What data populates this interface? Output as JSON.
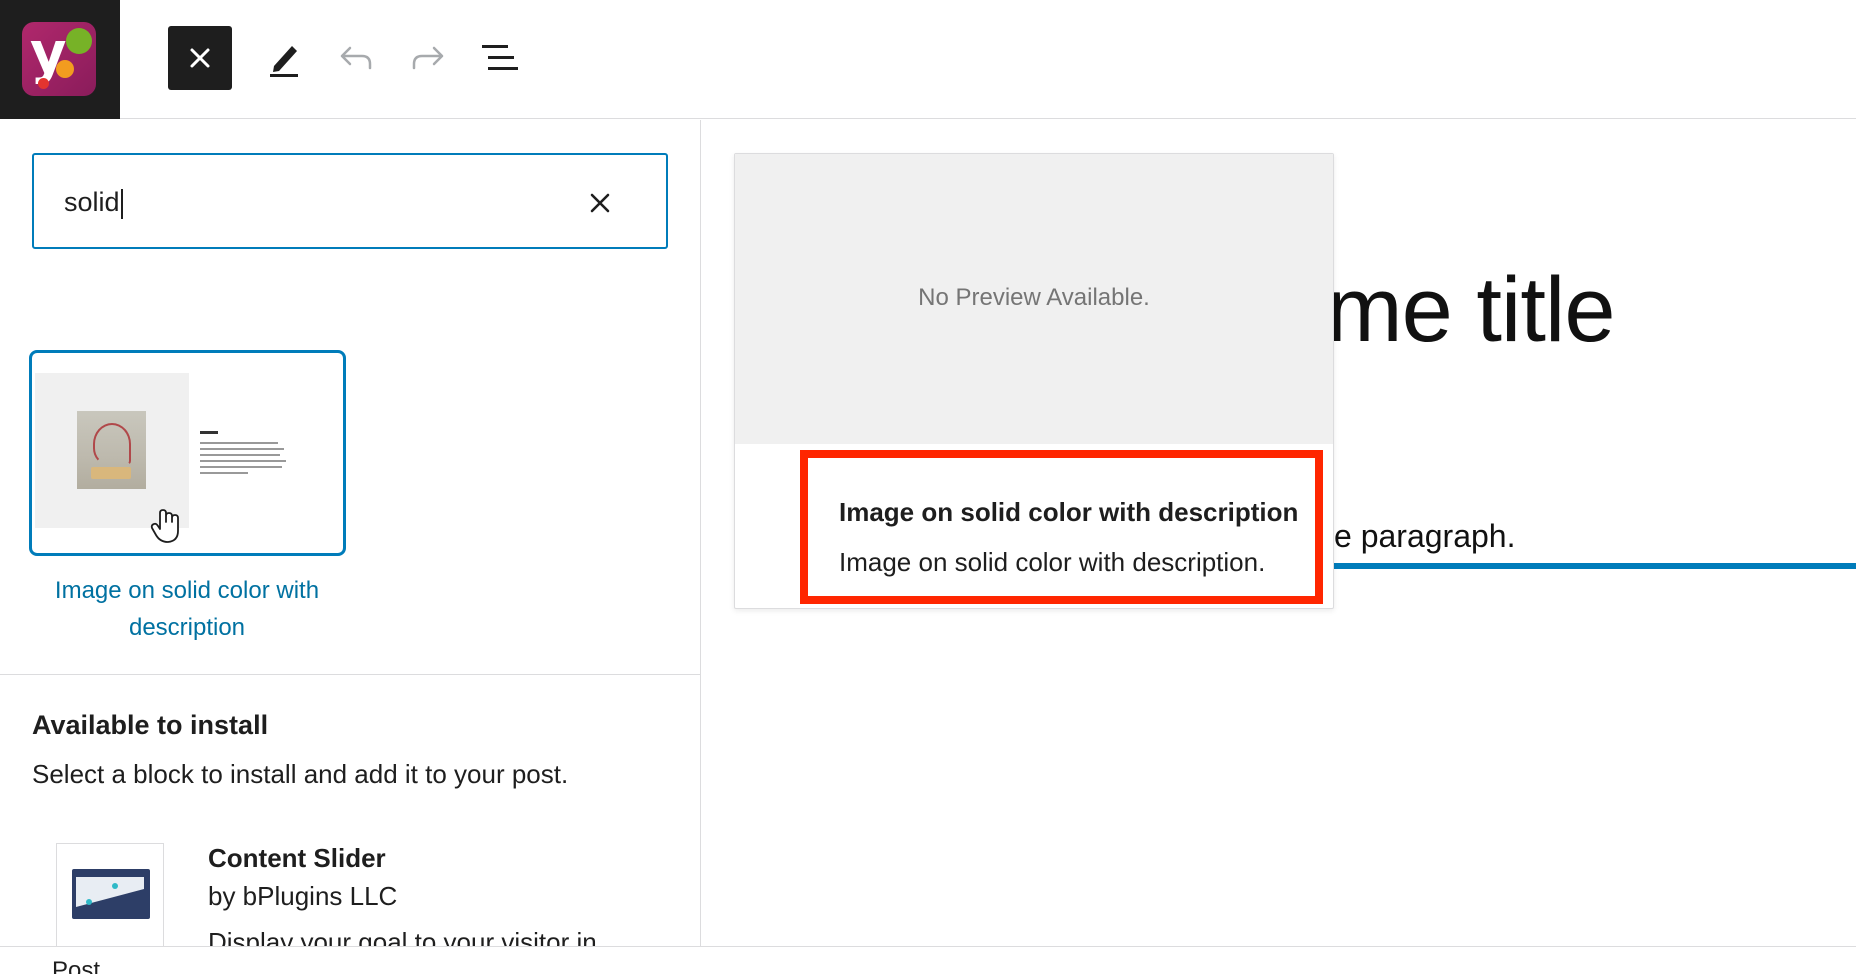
{
  "toolbar": {
    "close_icon": "close-icon",
    "edit_icon": "pencil-icon",
    "undo_icon": "undo-icon",
    "redo_icon": "redo-icon",
    "outline_icon": "list-view-icon"
  },
  "search": {
    "value": "solid",
    "clear_icon": "close-icon"
  },
  "pattern": {
    "label": "Image on solid color with description"
  },
  "install": {
    "title": "Available to install",
    "subtitle": "Select a block to install and add it to your post.",
    "plugin": {
      "name": "Content Slider",
      "author": "by bPlugins LLC",
      "description": "Display your goal to your visitor in"
    }
  },
  "editor": {
    "title_visible": "me title",
    "paragraph_visible": "e paragraph."
  },
  "preview": {
    "empty_message": "No Preview Available.",
    "title": "Image on solid color with description",
    "description": "Image on solid color with description."
  },
  "footer": {
    "label": "Post"
  },
  "colors": {
    "accent": "#007cba",
    "link": "#0071a1",
    "highlight": "#ff2600",
    "dark": "#1e1e1e"
  }
}
